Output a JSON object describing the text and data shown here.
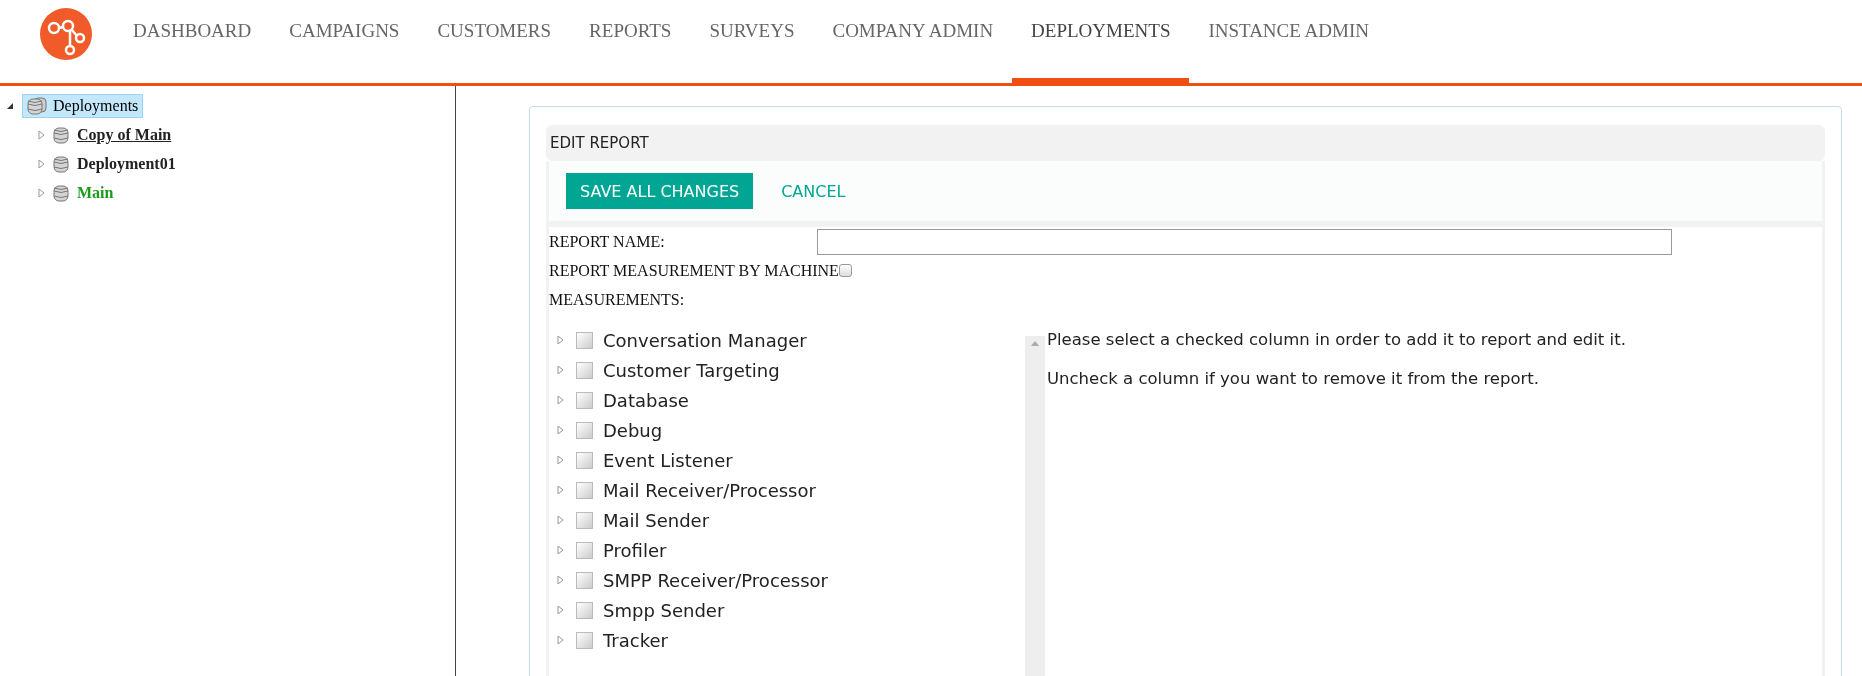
{
  "nav": {
    "items": [
      {
        "label": "DASHBOARD",
        "selected": false
      },
      {
        "label": "CAMPAIGNS",
        "selected": false
      },
      {
        "label": "CUSTOMERS",
        "selected": false
      },
      {
        "label": "REPORTS",
        "selected": false
      },
      {
        "label": "SURVEYS",
        "selected": false
      },
      {
        "label": "COMPANY ADMIN",
        "selected": false
      },
      {
        "label": "DEPLOYMENTS",
        "selected": true
      },
      {
        "label": "INSTANCE ADMIN",
        "selected": false
      }
    ]
  },
  "sidebar": {
    "tree": {
      "label": "Deployments",
      "selected": true,
      "expanded": true,
      "children": [
        {
          "label": "Copy of Main",
          "expanded": false,
          "hovered": true,
          "active": false
        },
        {
          "label": "Deployment01",
          "expanded": false,
          "hovered": false,
          "active": false
        },
        {
          "label": "Main",
          "expanded": false,
          "hovered": false,
          "active": true
        }
      ]
    }
  },
  "panel": {
    "title": "EDIT REPORT",
    "save_button": "SAVE ALL CHANGES",
    "cancel_link": "CANCEL",
    "report_name_label": "REPORT NAME:",
    "by_machine_label": "REPORT MEASUREMENT BY MACHINE",
    "by_machine_checked": false,
    "measurements_label": "MEASUREMENTS:",
    "measurements": [
      {
        "label": "Conversation Manager",
        "checked": false,
        "expanded": false
      },
      {
        "label": "Customer Targeting",
        "checked": false,
        "expanded": false
      },
      {
        "label": "Database",
        "checked": false,
        "expanded": false
      },
      {
        "label": "Debug",
        "checked": false,
        "expanded": false
      },
      {
        "label": "Event Listener",
        "checked": false,
        "expanded": false
      },
      {
        "label": "Mail Receiver/Processor",
        "checked": false,
        "expanded": false
      },
      {
        "label": "Mail Sender",
        "checked": false,
        "expanded": false
      },
      {
        "label": "Profiler",
        "checked": false,
        "expanded": false
      },
      {
        "label": "SMPP Receiver/Processor",
        "checked": false,
        "expanded": false
      },
      {
        "label": "Smpp Sender",
        "checked": false,
        "expanded": false
      },
      {
        "label": "Tracker",
        "checked": false,
        "expanded": false
      }
    ],
    "help": [
      "Please select a checked column in order to add it to report and edit it.",
      "Uncheck a column if you want to remove it from the report."
    ]
  }
}
